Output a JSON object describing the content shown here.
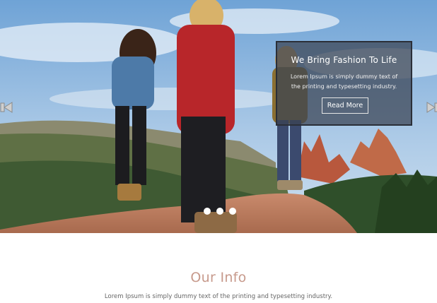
{
  "slider": {
    "caption_title": "We Bring Fashion To Life",
    "caption_text": "Lorem Ipsum is simply dummy text of the printing and typesetting industry.",
    "button_label": "Read More",
    "current_slide": 1,
    "total_slides": 3,
    "prev_icon": "arrow-left-icon",
    "next_icon": "arrow-right-icon"
  },
  "info": {
    "title": "Our Info",
    "text": "Lorem Ipsum is simply dummy text of the printing and typesetting industry."
  },
  "colors": {
    "accent": "#c79a8c",
    "caption_bg": "#3a4252"
  }
}
